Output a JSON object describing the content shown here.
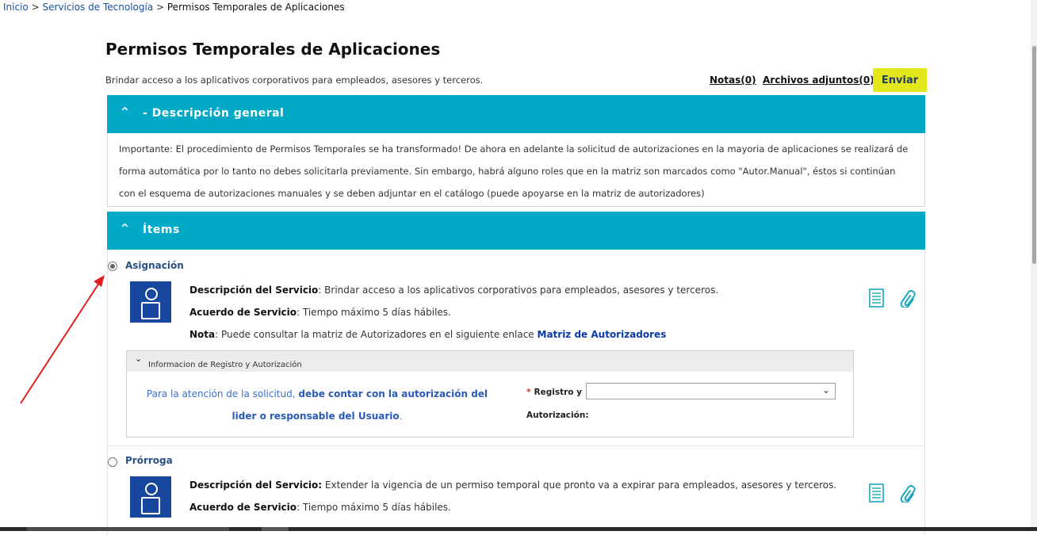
{
  "breadcrumb": {
    "inicio": "Inicio",
    "sep1": " > ",
    "servicios": "Servicios de Tecnología",
    "sep2": " > ",
    "current": "Permisos Temporales de Aplicaciones"
  },
  "page": {
    "title": "Permisos Temporales de Aplicaciones",
    "subtitle": "Brindar acceso a los aplicativos corporativos para empleados, asesores y terceros.",
    "notas": "Notas(0)",
    "adjuntos": "Archivos adjuntos(0)",
    "enviar": "Enviar"
  },
  "descripcion_general": {
    "chevron": "^",
    "title": "- Descripción general",
    "text": "Importante: El procedimiento de Permisos Temporales se ha transformado! De ahora en adelante la solicitud de autorizaciones en la mayoria de aplicaciones se realizará de forma automática por lo tanto no debes solicitarla previamente. Sin embargo, habrá alguno roles que en la matriz son marcados como \"Autor.Manual\", éstos si continúan con el esquema de autorizaciones manuales y se deben adjuntar en el catálogo (puede apoyarse en la matriz de autorizadores)"
  },
  "items_section": {
    "chevron": "^",
    "title": "Ítems"
  },
  "items": [
    {
      "name": "Asignación",
      "selected": true,
      "desc_label": "Descripción del Servicio",
      "desc_text": ": Brindar acceso a los aplicativos corporativos para empleados, asesores y terceros.",
      "acuerdo_label": "Acuerdo de Servicio",
      "acuerdo_text": ": Tiempo máximo 5 días hábiles.",
      "nota_label": "Nota",
      "nota_text": ": Puede consultar la matriz de Autorizadores en el siguiente enlace ",
      "nota_link": "Matriz de Autorizadores",
      "subpanel": {
        "title": "Informacion de Registro y Autorización",
        "note_plain": "Para la atención de la solicitud, ",
        "note_bold": "debe contar con la autorización del lider o responsable del Usuario",
        "note_end": ".",
        "field_label_1": "Registro y",
        "field_label_2": "Autorización:",
        "required_mark": "*",
        "select_value": ""
      }
    },
    {
      "name": "Prórroga",
      "selected": false,
      "desc_label": "Descripción del Servicio:",
      "desc_text": " Extender la vigencia de un permiso temporal que pronto va a expirar para empleados, asesores y terceros.",
      "acuerdo_label": "Acuerdo de Servicio",
      "acuerdo_text": ": Tiempo máximo 5 días hábiles."
    }
  ],
  "icons": {
    "doc": "document-icon",
    "clip": "paperclip-icon",
    "avatar": "user-avatar-icon"
  },
  "colors": {
    "section_header": "#00a9c6",
    "enviar_button": "#e3e81c",
    "avatar_bg": "#17479e",
    "link": "#0b3aa6",
    "annotation_arrow": "#e02020"
  }
}
